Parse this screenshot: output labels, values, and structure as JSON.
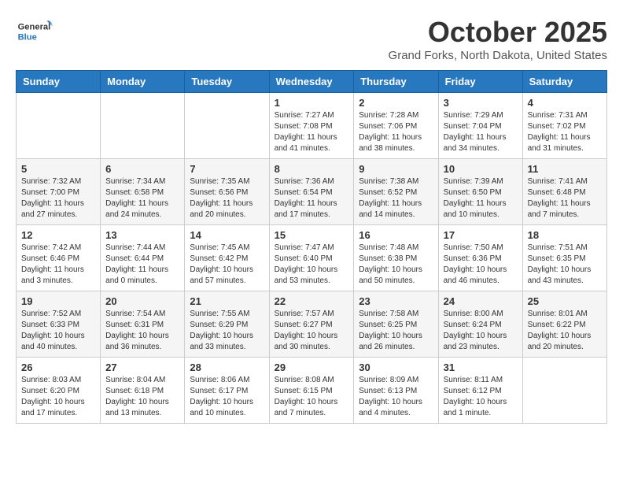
{
  "header": {
    "logo_general": "General",
    "logo_blue": "Blue",
    "title": "October 2025",
    "location": "Grand Forks, North Dakota, United States"
  },
  "weekdays": [
    "Sunday",
    "Monday",
    "Tuesday",
    "Wednesday",
    "Thursday",
    "Friday",
    "Saturday"
  ],
  "weeks": [
    [
      {
        "day": "",
        "info": ""
      },
      {
        "day": "",
        "info": ""
      },
      {
        "day": "",
        "info": ""
      },
      {
        "day": "1",
        "info": "Sunrise: 7:27 AM\nSunset: 7:08 PM\nDaylight: 11 hours and 41 minutes."
      },
      {
        "day": "2",
        "info": "Sunrise: 7:28 AM\nSunset: 7:06 PM\nDaylight: 11 hours and 38 minutes."
      },
      {
        "day": "3",
        "info": "Sunrise: 7:29 AM\nSunset: 7:04 PM\nDaylight: 11 hours and 34 minutes."
      },
      {
        "day": "4",
        "info": "Sunrise: 7:31 AM\nSunset: 7:02 PM\nDaylight: 11 hours and 31 minutes."
      }
    ],
    [
      {
        "day": "5",
        "info": "Sunrise: 7:32 AM\nSunset: 7:00 PM\nDaylight: 11 hours and 27 minutes."
      },
      {
        "day": "6",
        "info": "Sunrise: 7:34 AM\nSunset: 6:58 PM\nDaylight: 11 hours and 24 minutes."
      },
      {
        "day": "7",
        "info": "Sunrise: 7:35 AM\nSunset: 6:56 PM\nDaylight: 11 hours and 20 minutes."
      },
      {
        "day": "8",
        "info": "Sunrise: 7:36 AM\nSunset: 6:54 PM\nDaylight: 11 hours and 17 minutes."
      },
      {
        "day": "9",
        "info": "Sunrise: 7:38 AM\nSunset: 6:52 PM\nDaylight: 11 hours and 14 minutes."
      },
      {
        "day": "10",
        "info": "Sunrise: 7:39 AM\nSunset: 6:50 PM\nDaylight: 11 hours and 10 minutes."
      },
      {
        "day": "11",
        "info": "Sunrise: 7:41 AM\nSunset: 6:48 PM\nDaylight: 11 hours and 7 minutes."
      }
    ],
    [
      {
        "day": "12",
        "info": "Sunrise: 7:42 AM\nSunset: 6:46 PM\nDaylight: 11 hours and 3 minutes."
      },
      {
        "day": "13",
        "info": "Sunrise: 7:44 AM\nSunset: 6:44 PM\nDaylight: 11 hours and 0 minutes."
      },
      {
        "day": "14",
        "info": "Sunrise: 7:45 AM\nSunset: 6:42 PM\nDaylight: 10 hours and 57 minutes."
      },
      {
        "day": "15",
        "info": "Sunrise: 7:47 AM\nSunset: 6:40 PM\nDaylight: 10 hours and 53 minutes."
      },
      {
        "day": "16",
        "info": "Sunrise: 7:48 AM\nSunset: 6:38 PM\nDaylight: 10 hours and 50 minutes."
      },
      {
        "day": "17",
        "info": "Sunrise: 7:50 AM\nSunset: 6:36 PM\nDaylight: 10 hours and 46 minutes."
      },
      {
        "day": "18",
        "info": "Sunrise: 7:51 AM\nSunset: 6:35 PM\nDaylight: 10 hours and 43 minutes."
      }
    ],
    [
      {
        "day": "19",
        "info": "Sunrise: 7:52 AM\nSunset: 6:33 PM\nDaylight: 10 hours and 40 minutes."
      },
      {
        "day": "20",
        "info": "Sunrise: 7:54 AM\nSunset: 6:31 PM\nDaylight: 10 hours and 36 minutes."
      },
      {
        "day": "21",
        "info": "Sunrise: 7:55 AM\nSunset: 6:29 PM\nDaylight: 10 hours and 33 minutes."
      },
      {
        "day": "22",
        "info": "Sunrise: 7:57 AM\nSunset: 6:27 PM\nDaylight: 10 hours and 30 minutes."
      },
      {
        "day": "23",
        "info": "Sunrise: 7:58 AM\nSunset: 6:25 PM\nDaylight: 10 hours and 26 minutes."
      },
      {
        "day": "24",
        "info": "Sunrise: 8:00 AM\nSunset: 6:24 PM\nDaylight: 10 hours and 23 minutes."
      },
      {
        "day": "25",
        "info": "Sunrise: 8:01 AM\nSunset: 6:22 PM\nDaylight: 10 hours and 20 minutes."
      }
    ],
    [
      {
        "day": "26",
        "info": "Sunrise: 8:03 AM\nSunset: 6:20 PM\nDaylight: 10 hours and 17 minutes."
      },
      {
        "day": "27",
        "info": "Sunrise: 8:04 AM\nSunset: 6:18 PM\nDaylight: 10 hours and 13 minutes."
      },
      {
        "day": "28",
        "info": "Sunrise: 8:06 AM\nSunset: 6:17 PM\nDaylight: 10 hours and 10 minutes."
      },
      {
        "day": "29",
        "info": "Sunrise: 8:08 AM\nSunset: 6:15 PM\nDaylight: 10 hours and 7 minutes."
      },
      {
        "day": "30",
        "info": "Sunrise: 8:09 AM\nSunset: 6:13 PM\nDaylight: 10 hours and 4 minutes."
      },
      {
        "day": "31",
        "info": "Sunrise: 8:11 AM\nSunset: 6:12 PM\nDaylight: 10 hours and 1 minute."
      },
      {
        "day": "",
        "info": ""
      }
    ]
  ]
}
